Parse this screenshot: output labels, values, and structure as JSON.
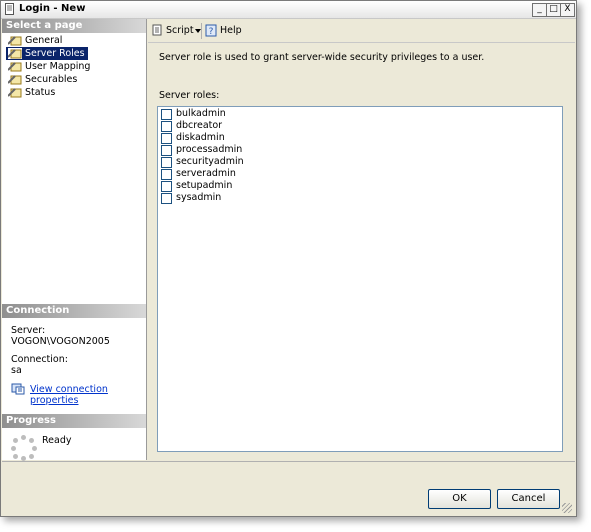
{
  "window": {
    "title": "Login - New",
    "controls": [
      "_",
      "□",
      "X"
    ]
  },
  "left_pane": {
    "select_page_header": "Select a page",
    "pages": [
      {
        "label": "General",
        "icon": "wrench-page-icon",
        "selected": false
      },
      {
        "label": "Server Roles",
        "icon": "wrench-page-icon",
        "selected": true
      },
      {
        "label": "User Mapping",
        "icon": "wrench-page-icon",
        "selected": false
      },
      {
        "label": "Securables",
        "icon": "wrench-page-icon",
        "selected": false
      },
      {
        "label": "Status",
        "icon": "wrench-page-icon",
        "selected": false
      }
    ],
    "connection_header": "Connection",
    "server_label": "Server:",
    "server_value": "VOGON\\VOGON2005",
    "connection_label": "Connection:",
    "connection_value": "sa",
    "view_connection_link": "View connection properties",
    "progress_header": "Progress",
    "progress_status": "Ready"
  },
  "toolbar": {
    "script_label": "Script",
    "help_label": "Help"
  },
  "main": {
    "description": "Server role is used to grant server-wide security privileges to a user.",
    "roles_label": "Server roles:",
    "roles": [
      {
        "name": "bulkadmin",
        "checked": false
      },
      {
        "name": "dbcreator",
        "checked": false
      },
      {
        "name": "diskadmin",
        "checked": false
      },
      {
        "name": "processadmin",
        "checked": false
      },
      {
        "name": "securityadmin",
        "checked": false
      },
      {
        "name": "serveradmin",
        "checked": false
      },
      {
        "name": "setupadmin",
        "checked": false
      },
      {
        "name": "sysadmin",
        "checked": false
      }
    ]
  },
  "buttons": {
    "ok": "OK",
    "cancel": "Cancel"
  },
  "colors": {
    "selection": "#0a246a",
    "link": "#0033cc",
    "dialog_bg": "#ece9d8"
  }
}
